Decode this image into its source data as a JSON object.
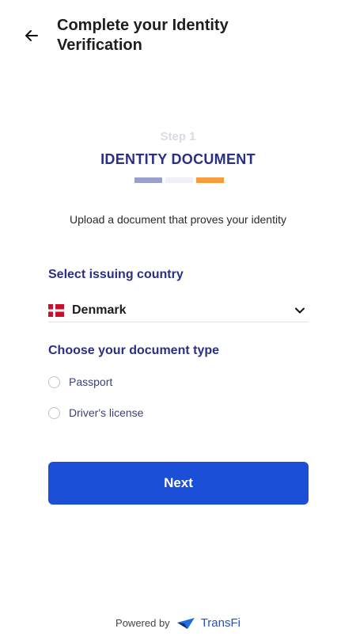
{
  "header": {
    "title": "Complete your Identity Verification",
    "back_icon": "arrow-left-icon"
  },
  "step": {
    "label": "Step 1",
    "name": "IDENTITY DOCUMENT",
    "progress_colors": [
      "#9a9fcb",
      "#eef0f6",
      "#f89b3d"
    ]
  },
  "intro": "Upload a document that proves your identity",
  "country": {
    "label": "Select issuing country",
    "value": "Denmark",
    "flag_icon": "denmark-flag-icon",
    "chevron_icon": "chevron-down-icon"
  },
  "document": {
    "label": "Choose your document type",
    "options": [
      {
        "label": "Passport",
        "selected": false
      },
      {
        "label": "Driver's license",
        "selected": false
      }
    ]
  },
  "actions": {
    "next_label": "Next"
  },
  "footer": {
    "powered_by": "Powered by",
    "brand": "TransFi"
  },
  "colors": {
    "primary": "#1c4fd8",
    "heading": "#2a2f86",
    "accent_orange": "#f89b3d"
  }
}
